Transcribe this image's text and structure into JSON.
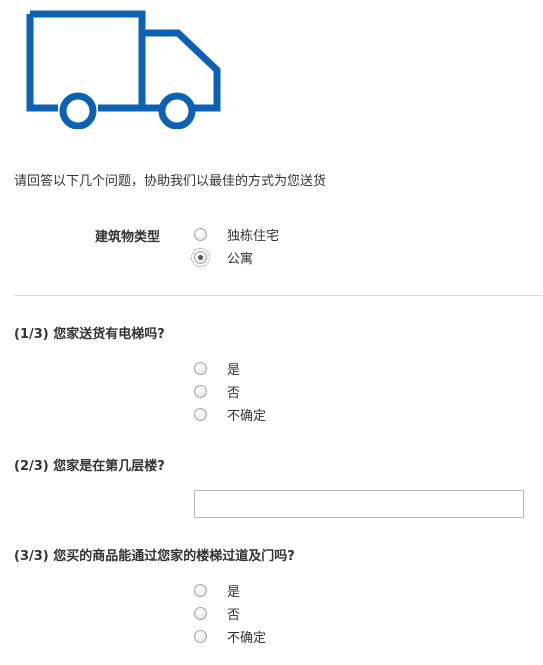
{
  "brand": {
    "accent_color": "#0b61b3",
    "icon": "delivery-truck-icon"
  },
  "intro_text": "请回答以下几个问题，协助我们以最佳的方式为您送货",
  "building_type": {
    "label": "建筑物类型",
    "options": [
      {
        "label": "独栋住宅",
        "selected": false
      },
      {
        "label": "公寓",
        "selected": true
      }
    ]
  },
  "questions": [
    {
      "title": "(1/3) 您家送货有电梯吗?",
      "type": "radio",
      "options": [
        {
          "label": "是",
          "selected": false
        },
        {
          "label": "否",
          "selected": false
        },
        {
          "label": "不确定",
          "selected": false
        }
      ]
    },
    {
      "title": "(2/3) 您家是在第几层楼?",
      "type": "text",
      "value": "",
      "placeholder": ""
    },
    {
      "title": "(3/3) 您买的商品能通过您家的楼梯过道及门吗?",
      "type": "radio",
      "options": [
        {
          "label": "是",
          "selected": false
        },
        {
          "label": "否",
          "selected": false
        },
        {
          "label": "不确定",
          "selected": false
        }
      ]
    }
  ]
}
